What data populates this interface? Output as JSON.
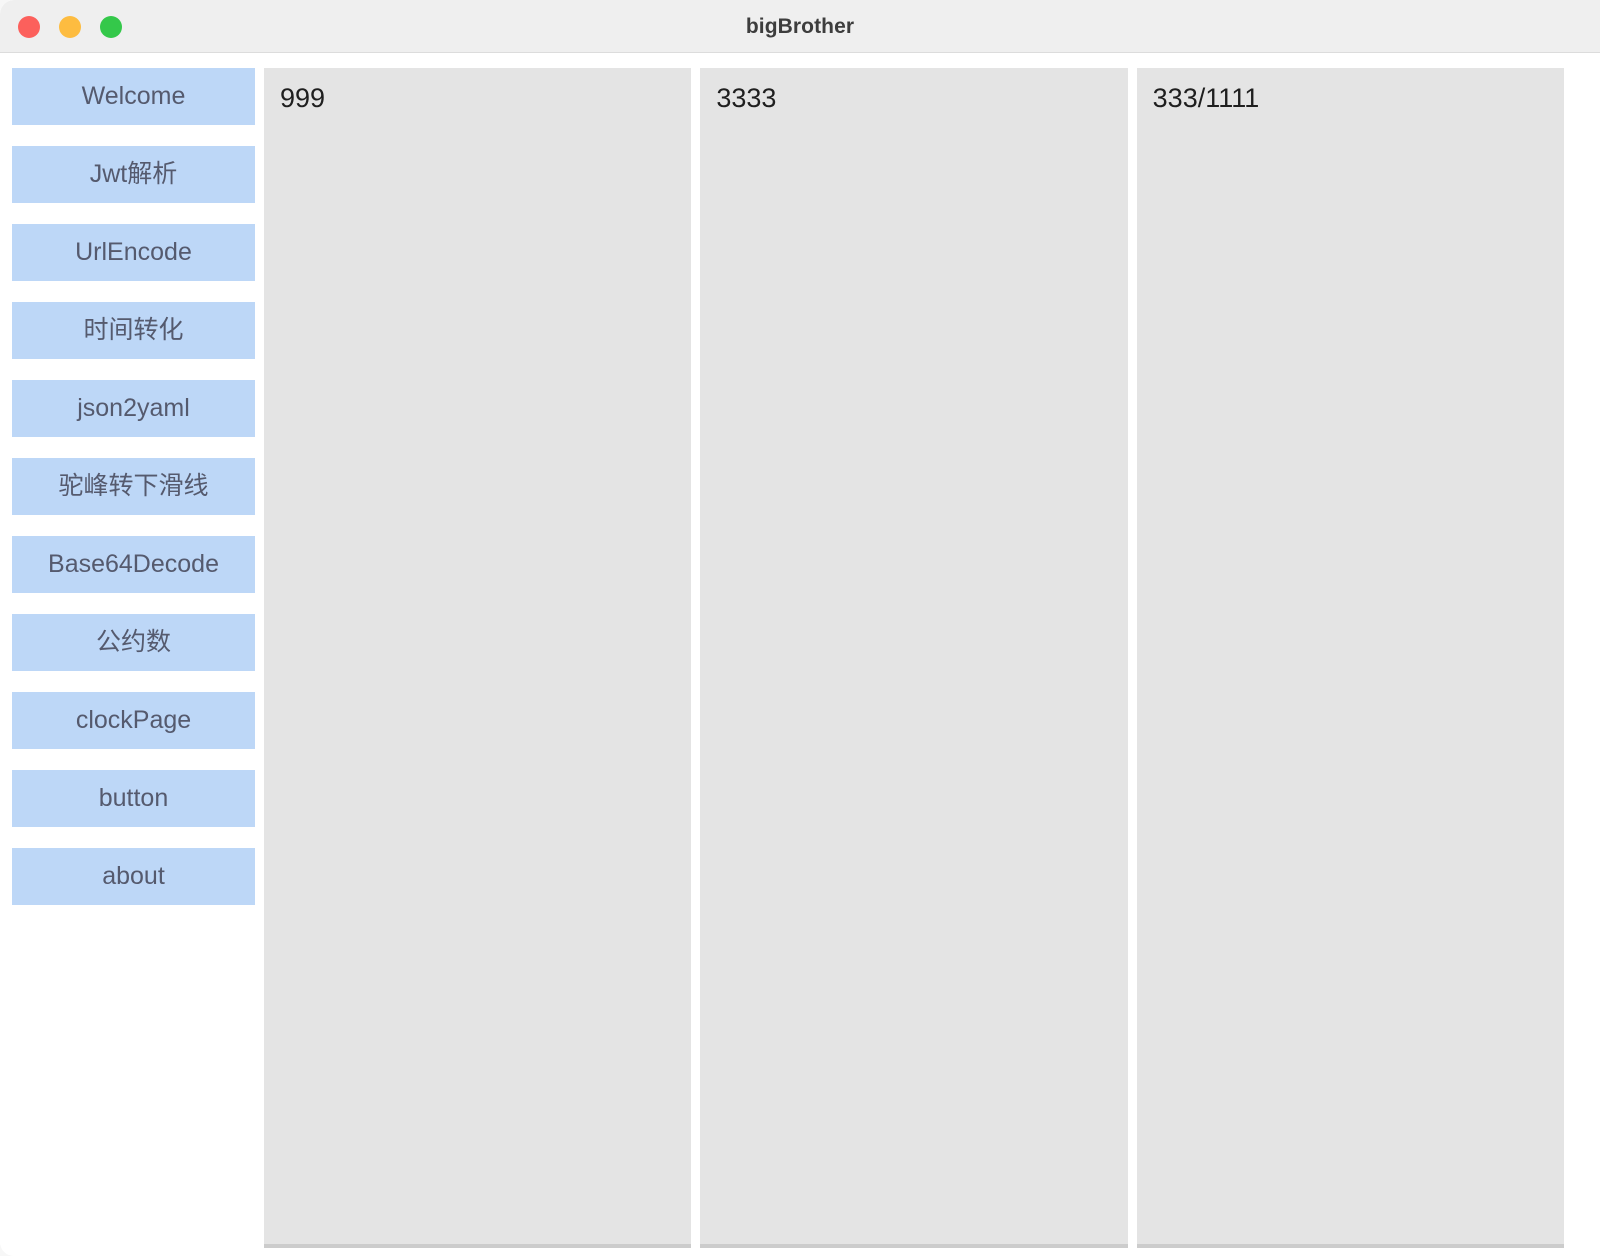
{
  "window": {
    "title": "bigBrother",
    "controls": [
      {
        "name": "close",
        "color": "#fc605c"
      },
      {
        "name": "minimize",
        "color": "#fdbc40"
      },
      {
        "name": "zoom",
        "color": "#34c84a"
      }
    ]
  },
  "sidebar": {
    "items": [
      {
        "id": "welcome",
        "label": "Welcome"
      },
      {
        "id": "jwt-parse",
        "label": "Jwt解析"
      },
      {
        "id": "url-encode",
        "label": "UrlEncode"
      },
      {
        "id": "time-convert",
        "label": "时间转化"
      },
      {
        "id": "json2yaml",
        "label": "json2yaml"
      },
      {
        "id": "camel-to-snake",
        "label": "驼峰转下滑线"
      },
      {
        "id": "base64decode",
        "label": "Base64Decode"
      },
      {
        "id": "common-divisor",
        "label": "公约数"
      },
      {
        "id": "clockpage",
        "label": "clockPage"
      },
      {
        "id": "button",
        "label": "button"
      },
      {
        "id": "about",
        "label": "about"
      }
    ]
  },
  "content": {
    "panels": [
      {
        "id": "panel-1",
        "label": "999"
      },
      {
        "id": "panel-2",
        "label": "3333"
      },
      {
        "id": "panel-3",
        "label": "333/1111"
      }
    ]
  },
  "colors": {
    "nav_item_background": "#bdd7f7",
    "nav_item_text": "#555a6e",
    "panel_background": "#e4e4e4",
    "titlebar_background": "#efefef",
    "window_background": "#ffffff"
  }
}
